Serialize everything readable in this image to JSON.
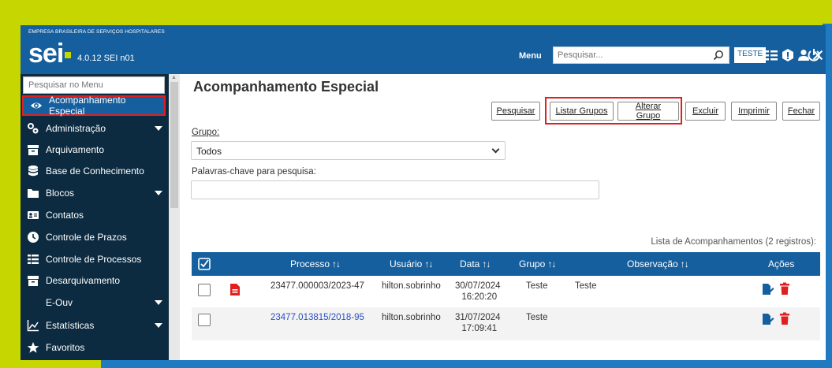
{
  "header": {
    "org_name": "EMPRESA BRASILEIRA DE SERVIÇOS HOSPITALARES",
    "logo_text": "sei",
    "version": "4.0.12 SEI n01",
    "menu_label": "Menu",
    "search_placeholder": "Pesquisar...",
    "unit": "TESTE"
  },
  "sidebar": {
    "search_placeholder": "Pesquisar no Menu",
    "items": [
      {
        "label": "Acompanhamento Especial",
        "icon": "eye-icon"
      },
      {
        "label": "Administração",
        "icon": "gears-icon"
      },
      {
        "label": "Arquivamento",
        "icon": "archive-box-icon"
      },
      {
        "label": "Base de Conhecimento",
        "icon": "database-icon"
      },
      {
        "label": "Blocos",
        "icon": "folder-icon"
      },
      {
        "label": "Contatos",
        "icon": "contact-card-icon"
      },
      {
        "label": "Controle de Prazos",
        "icon": "clock-icon"
      },
      {
        "label": "Controle de Processos",
        "icon": "list-icon"
      },
      {
        "label": "Desarquivamento",
        "icon": "archive-box-icon"
      },
      {
        "label": "E-Ouv",
        "icon": ""
      },
      {
        "label": "Estatísticas",
        "icon": "chart-line-icon"
      },
      {
        "label": "Favoritos",
        "icon": "star-icon"
      }
    ]
  },
  "main": {
    "title": "Acompanhamento Especial",
    "buttons": {
      "pesquisar": "Pesquisar",
      "listar_grupos": "Listar Grupos",
      "alterar_grupo": "Alterar Grupo",
      "excluir": "Excluir",
      "imprimir": "Imprimir",
      "fechar": "Fechar"
    },
    "grupo_label": "Grupo:",
    "grupo_value": "Todos",
    "keywords_label": "Palavras-chave para pesquisa:",
    "list_caption": "Lista de Acompanhamentos (2 registros):",
    "table": {
      "headers": {
        "processo": "Processo",
        "usuario": "Usuário",
        "data": "Data",
        "grupo": "Grupo",
        "observacao": "Observação",
        "acoes": "Ações"
      },
      "rows": [
        {
          "processo": "23477.000003/2023-47",
          "usuario": "hilton.sobrinho",
          "data": "30/07/2024",
          "hora": "16:20:20",
          "grupo": "Teste",
          "observacao": "Teste"
        },
        {
          "processo": "23477.013815/2018-95",
          "usuario": "hilton.sobrinho",
          "data": "31/07/2024",
          "hora": "17:09:41",
          "grupo": "Teste",
          "observacao": ""
        }
      ]
    }
  },
  "colors": {
    "header_blue": "#155f9e",
    "sidebar_dark": "#0c2b40",
    "accent_lime": "#c5d600",
    "highlight_red": "#e02020",
    "delete_red": "#e02020",
    "link_blue": "#2a4fbf"
  }
}
